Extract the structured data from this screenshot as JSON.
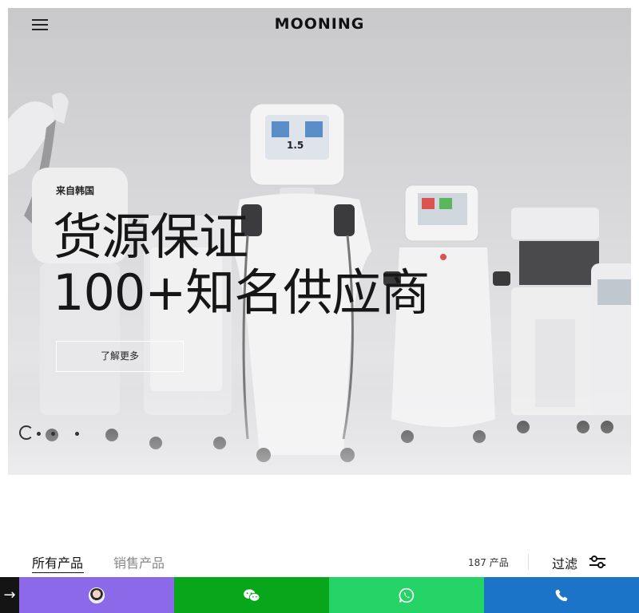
{
  "header": {
    "logo": "MOONING",
    "menu_icon": "hamburger-menu-icon"
  },
  "hero": {
    "kicker": "来自韩国",
    "headline_line1": "货源保证",
    "headline_line2": "100+知名供应商",
    "cta_label": "了解更多",
    "slides": [
      {
        "active": true
      },
      {
        "active": false
      },
      {
        "active": false
      },
      {
        "active": false
      }
    ]
  },
  "products": {
    "tabs": [
      {
        "label": "所有产品",
        "active": true
      },
      {
        "label": "销售产品",
        "active": false
      }
    ],
    "count_number": "187",
    "count_unit": "产品",
    "filter_label": "过滤",
    "filter_icon": "sliders-filter-icon"
  },
  "contact_bar": {
    "arrow": "→",
    "items": [
      {
        "icon": "avatar-icon",
        "color": "#8b69e8"
      },
      {
        "icon": "wechat-icon",
        "color": "#08a61a"
      },
      {
        "icon": "whatsapp-icon",
        "color": "#25d366"
      },
      {
        "icon": "phone-icon",
        "color": "#1c74c9"
      }
    ]
  }
}
